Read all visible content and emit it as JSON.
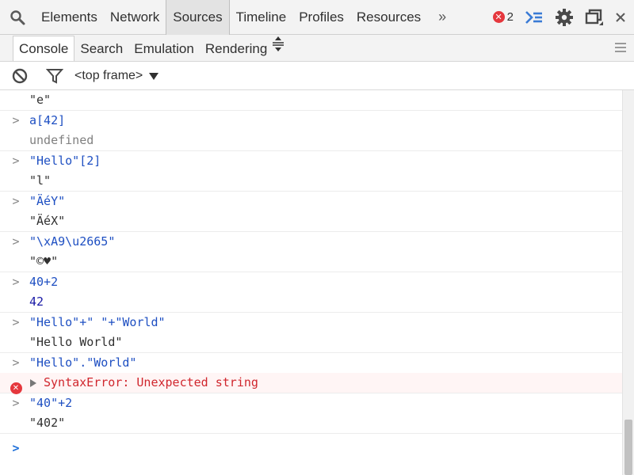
{
  "toolbar": {
    "tabs": [
      {
        "label": "Elements"
      },
      {
        "label": "Network"
      },
      {
        "label": "Sources"
      },
      {
        "label": "Timeline"
      },
      {
        "label": "Profiles"
      },
      {
        "label": "Resources"
      }
    ],
    "active_tab": "Sources",
    "overflow_label": "»",
    "error_count": "2"
  },
  "drawer": {
    "tabs": [
      {
        "label": "Console"
      },
      {
        "label": "Search"
      },
      {
        "label": "Emulation"
      },
      {
        "label": "Rendering"
      }
    ],
    "active_tab": "Console"
  },
  "filterbar": {
    "frame": "<top frame>"
  },
  "console": {
    "entries": [
      {
        "lines": [
          {
            "text": "\"e\"",
            "kind": "res"
          }
        ]
      },
      {
        "lines": [
          {
            "gutter": ">",
            "text": "a[42]",
            "kind": "cmd"
          },
          {
            "text": "undefined",
            "kind": "undef"
          }
        ]
      },
      {
        "lines": [
          {
            "gutter": ">",
            "text": "\"Hello\"[2]",
            "kind": "cmd"
          },
          {
            "text": "\"l\"",
            "kind": "res"
          }
        ]
      },
      {
        "lines": [
          {
            "gutter": ">",
            "text": "\"ÄéY\"",
            "kind": "cmd"
          },
          {
            "text": "\"ÄéХ\"",
            "kind": "res"
          }
        ]
      },
      {
        "lines": [
          {
            "gutter": ">",
            "text": "\"\\xA9\\u2665\"",
            "kind": "cmd"
          },
          {
            "text": "\"©♥\"",
            "kind": "res"
          }
        ]
      },
      {
        "lines": [
          {
            "gutter": ">",
            "text": "40+2",
            "kind": "cmd"
          },
          {
            "text": "42",
            "kind": "num"
          }
        ]
      },
      {
        "lines": [
          {
            "gutter": ">",
            "text": "\"Hello\"+\" \"+\"World\"",
            "kind": "cmd"
          },
          {
            "text": "\"Hello World\"",
            "kind": "res"
          }
        ]
      },
      {
        "lines": [
          {
            "gutter": ">",
            "text": "\"Hello\".\"World\"",
            "kind": "cmd"
          },
          {
            "gutter": "x",
            "text": "SyntaxError: Unexpected string",
            "kind": "err"
          }
        ]
      },
      {
        "lines": [
          {
            "gutter": ">",
            "text": "\"40\"+2",
            "kind": "cmd"
          },
          {
            "text": "\"402\"",
            "kind": "res"
          }
        ]
      }
    ],
    "prompt": ">"
  },
  "colors": {
    "command": "#1e4fc2",
    "error": "#d0262d",
    "active_tab_bg": "#e3e3e3"
  }
}
